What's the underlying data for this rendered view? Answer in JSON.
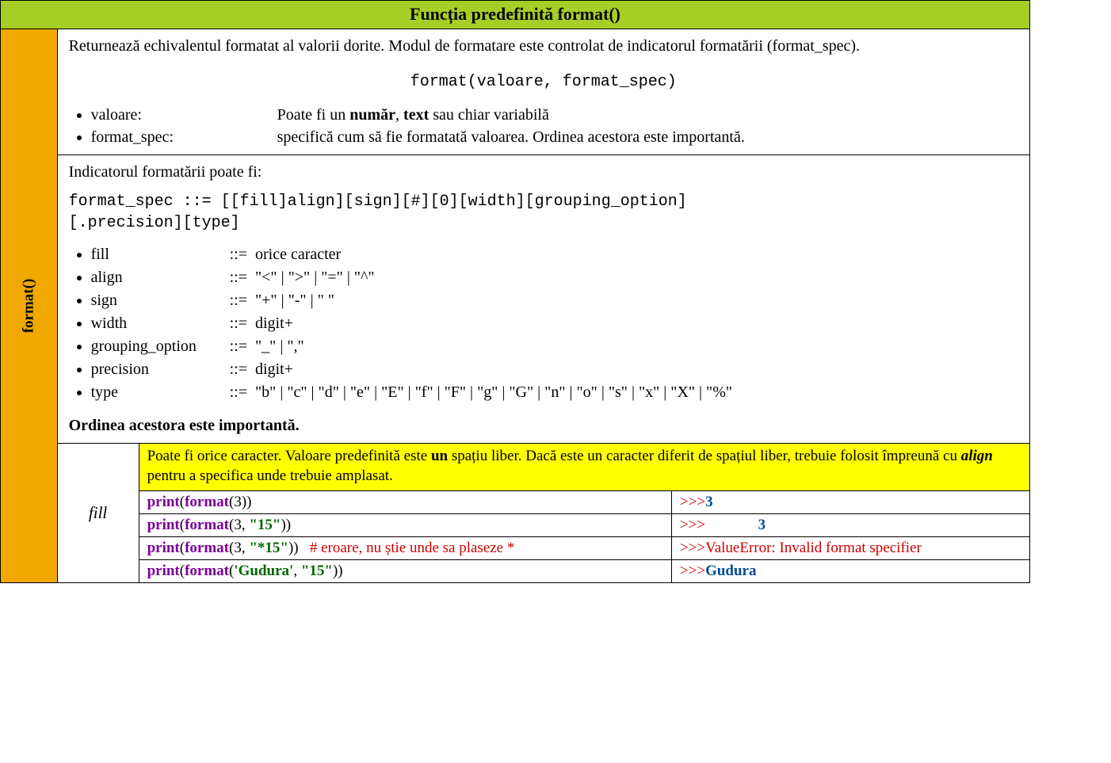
{
  "title": "Funcția predefinită format()",
  "side_label": "format()",
  "desc": {
    "intro": "Returnează echivalentul formatat al valorii dorite. Modul de formatare este controlat de indicatorul formatării (format_spec).",
    "signature": "format(valoare, format_spec)",
    "params": [
      {
        "name": "valoare:",
        "text_pre": "Poate fi un ",
        "b1": "număr",
        "mid": ", ",
        "b2": "text",
        "text_post": " sau chiar variabilă"
      },
      {
        "name": "format_spec:",
        "text": "specifică cum să fie formatată valoarea. Ordinea acestora este importantă."
      }
    ]
  },
  "spec": {
    "intro": "Indicatorul formatării poate fi:",
    "grammar_lhs": "format_spec     ::=  ",
    "grammar_rhs1": "[[fill]align][sign][#][0][width][grouping_option]",
    "grammar_rhs2": "[.precision][type]",
    "tokens": [
      {
        "name": "fill",
        "rhs": "orice caracter"
      },
      {
        "name": "align",
        "rhs": "\"<\" | \">\" | \"=\" | \"^\""
      },
      {
        "name": "sign",
        "rhs": "\"+\" | \"-\" | \" \""
      },
      {
        "name": "width",
        "rhs": "digit+"
      },
      {
        "name": "grouping_option",
        "rhs": "\"_\" | \",\""
      },
      {
        "name": "precision",
        "rhs": "digit+"
      },
      {
        "name": "type",
        "rhs": "\"b\" | \"c\" | \"d\" | \"e\" | \"E\" | \"f\" | \"F\" | \"g\" | \"G\" | \"n\" | \"o\" | \"s\" | \"x\" | \"X\" | \"%\""
      }
    ],
    "order_note": "Ordinea acestora este importantă."
  },
  "fill": {
    "label": "fill",
    "yellow_pre": "Poate fi orice caracter. Valoare predefinită este ",
    "yellow_b1": "un",
    "yellow_mid1": " spațiu liber. Dacă este un caracter diferit de spațiul liber, trebuie folosit împreună cu ",
    "yellow_bi": "align",
    "yellow_post": " pentru a specifica unde trebuie amplasat.",
    "rows": [
      {
        "print": "print",
        "fmt": "format",
        "open": "(",
        "args": "3",
        "close": "))",
        "str": null,
        "comment": null,
        "prompt": ">>>",
        "out": "3",
        "out_err": null,
        "pad": ""
      },
      {
        "print": "print",
        "fmt": "format",
        "open": "(",
        "args": "3, ",
        "close": "))",
        "str": "\"15\"",
        "comment": null,
        "prompt": ">>>",
        "out": "3",
        "out_err": null,
        "pad": "              "
      },
      {
        "print": "print",
        "fmt": "format",
        "open": "(",
        "args": "3, ",
        "close": "))",
        "str": "\"*15\"",
        "comment": "# eroare, nu știe unde sa plaseze *",
        "prompt": ">>>",
        "out": null,
        "out_err": "ValueError: Invalid format specifier",
        "pad": ""
      },
      {
        "print": "print",
        "fmt": "format",
        "open": "(",
        "args": "",
        "close": "))",
        "str1": "'Gudura'",
        "mid": ", ",
        "str": "\"15\"",
        "comment": null,
        "prompt": ">>>",
        "out": "Gudura",
        "out_err": null,
        "pad": ""
      }
    ]
  }
}
